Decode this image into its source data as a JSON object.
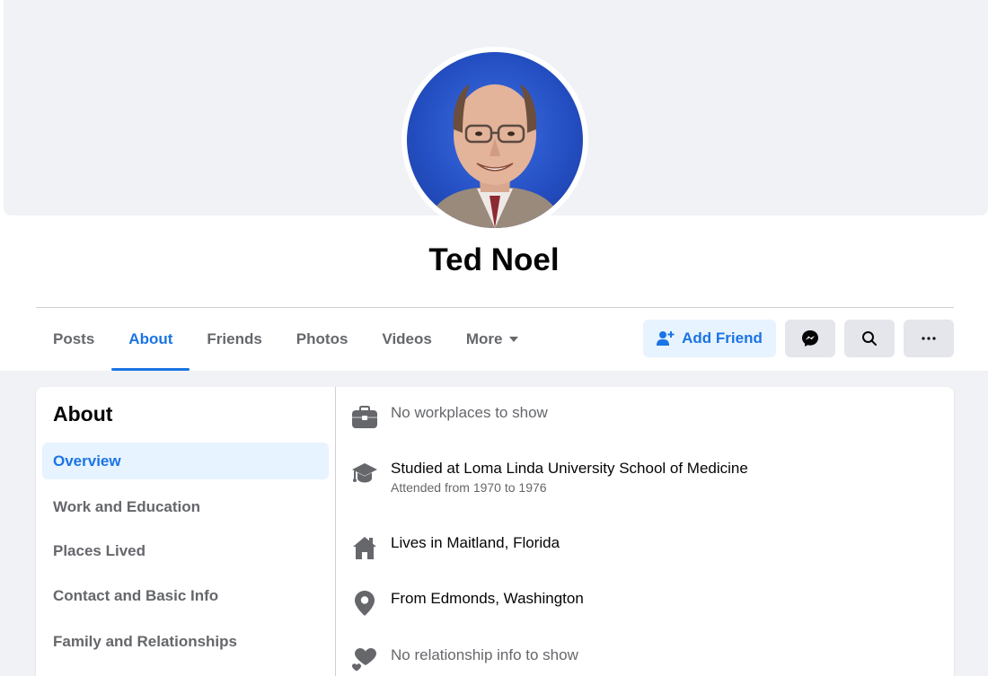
{
  "profile": {
    "name": "Ted Noel"
  },
  "tabs": [
    {
      "label": "Posts"
    },
    {
      "label": "About"
    },
    {
      "label": "Friends"
    },
    {
      "label": "Photos"
    },
    {
      "label": "Videos"
    },
    {
      "label": "More"
    }
  ],
  "actions": {
    "add_friend_label": "Add Friend"
  },
  "about": {
    "title": "About",
    "sidebar": [
      {
        "label": "Overview"
      },
      {
        "label": "Work and Education"
      },
      {
        "label": "Places Lived"
      },
      {
        "label": "Contact and Basic Info"
      },
      {
        "label": "Family and Relationships"
      }
    ],
    "overview": {
      "workplace": "No workplaces to show",
      "education": "Studied at Loma Linda University School of Medicine",
      "education_detail": "Attended from 1970 to 1976",
      "current_city": "Lives in Maitland, Florida",
      "hometown": "From Edmonds, Washington",
      "relationship": "No relationship info to show"
    }
  },
  "colors": {
    "accent": "#1b74e4",
    "accent_bg": "#e7f3ff",
    "page_bg": "#f0f2f5",
    "muted_text": "#65676b",
    "icon_gray": "#65676b"
  },
  "icons": {
    "workplace": "briefcase-icon",
    "education": "graduation-cap-icon",
    "current_city": "house-icon",
    "hometown": "location-pin-icon",
    "relationship": "hearts-icon"
  }
}
